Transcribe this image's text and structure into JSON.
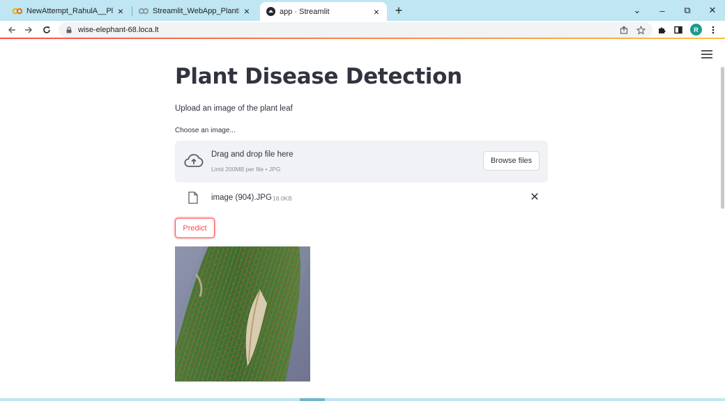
{
  "browser": {
    "tabs": [
      {
        "title": "NewAttempt_RahulA__PlantDise",
        "favicon": "colab-icon",
        "close": "×"
      },
      {
        "title": "Streamlit_WebApp_PlantDisease",
        "favicon": "colab-icon",
        "close": "×"
      },
      {
        "title": "app · Streamlit",
        "favicon": "streamlit-icon",
        "close": "×",
        "active": true
      }
    ],
    "new_tab": "+",
    "window_controls": {
      "dropdown": "⌄",
      "minimize": "–",
      "restore": "⧉",
      "close": "✕"
    },
    "url": "wise-elephant-68.loca.lt",
    "profile_initial": "R"
  },
  "app": {
    "title": "Plant Disease Detection",
    "subtitle": "Upload an image of the plant leaf",
    "uploader": {
      "label": "Choose an image...",
      "drag_text": "Drag and drop file here",
      "limit_text": "Limit 200MB per file • JPG",
      "browse_label": "Browse files"
    },
    "uploaded_file": {
      "name": "image (904).JPG",
      "size": "18.0KB",
      "remove": "✕"
    },
    "predict_label": "Predict"
  },
  "colors": {
    "accent": "#ff4b4b",
    "text": "#31333f",
    "dropzone_bg": "#f0f2f6",
    "tabbar_bg": "#bfe6f2"
  }
}
